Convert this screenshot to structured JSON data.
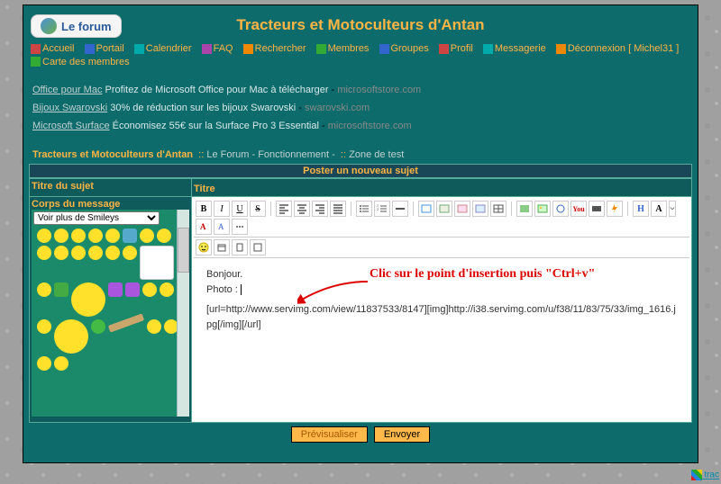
{
  "header": {
    "title": "Tracteurs et Motoculteurs d'Antan",
    "logo_text": "Le forum"
  },
  "nav": {
    "accueil": "Accueil",
    "portail": "Portail",
    "calendrier": "Calendrier",
    "faq": "FAQ",
    "rechercher": "Rechercher",
    "membres": "Membres",
    "groupes": "Groupes",
    "profil": "Profil",
    "messagerie": "Messagerie",
    "deconnexion": "Déconnexion [ Michel31 ]",
    "carte": "Carte des membres"
  },
  "ads": [
    {
      "title": "Office pour Mac",
      "text": "Profitez de Microsoft Office pour Mac à télécharger",
      "domain": "microsoftstore.com"
    },
    {
      "title": "Bijoux Swarovski",
      "text": "30% de réduction sur les bijoux Swarovski",
      "domain": "swarovski.com"
    },
    {
      "title": "Microsoft Surface",
      "text": "Économisez 55€ sur la Surface Pro 3 Essential",
      "domain": "microsoftstore.com"
    }
  ],
  "breadcrumb": {
    "brand": "Tracteurs et Motoculteurs d'Antan",
    "sep": "::",
    "link1": "Le Forum - Fonctionnement -",
    "link2": "Zone de test"
  },
  "post": {
    "header": "Poster un nouveau sujet",
    "title_label": "Titre du sujet",
    "title_field_label": "Titre",
    "body_label": "Corps du message",
    "smiley_select": "Voir plus de Smileys"
  },
  "toolbar": {
    "b": "B",
    "i": "I",
    "u": "U",
    "s": "S",
    "h_btn": "H",
    "a_btn": "A"
  },
  "editor": {
    "line1": "Bonjour.",
    "line2": "Photo :",
    "code": "[url=http://www.servimg.com/view/11837533/8147][img]http://i38.servimg.com/u/f38/11/83/75/33/img_1616.jpg[/img][/url]",
    "annotation": "Clic sur le point d'insertion puis \"Ctrl+v\""
  },
  "buttons": {
    "preview": "Prévisualiser",
    "submit": "Envoyer"
  },
  "corner": "trac"
}
